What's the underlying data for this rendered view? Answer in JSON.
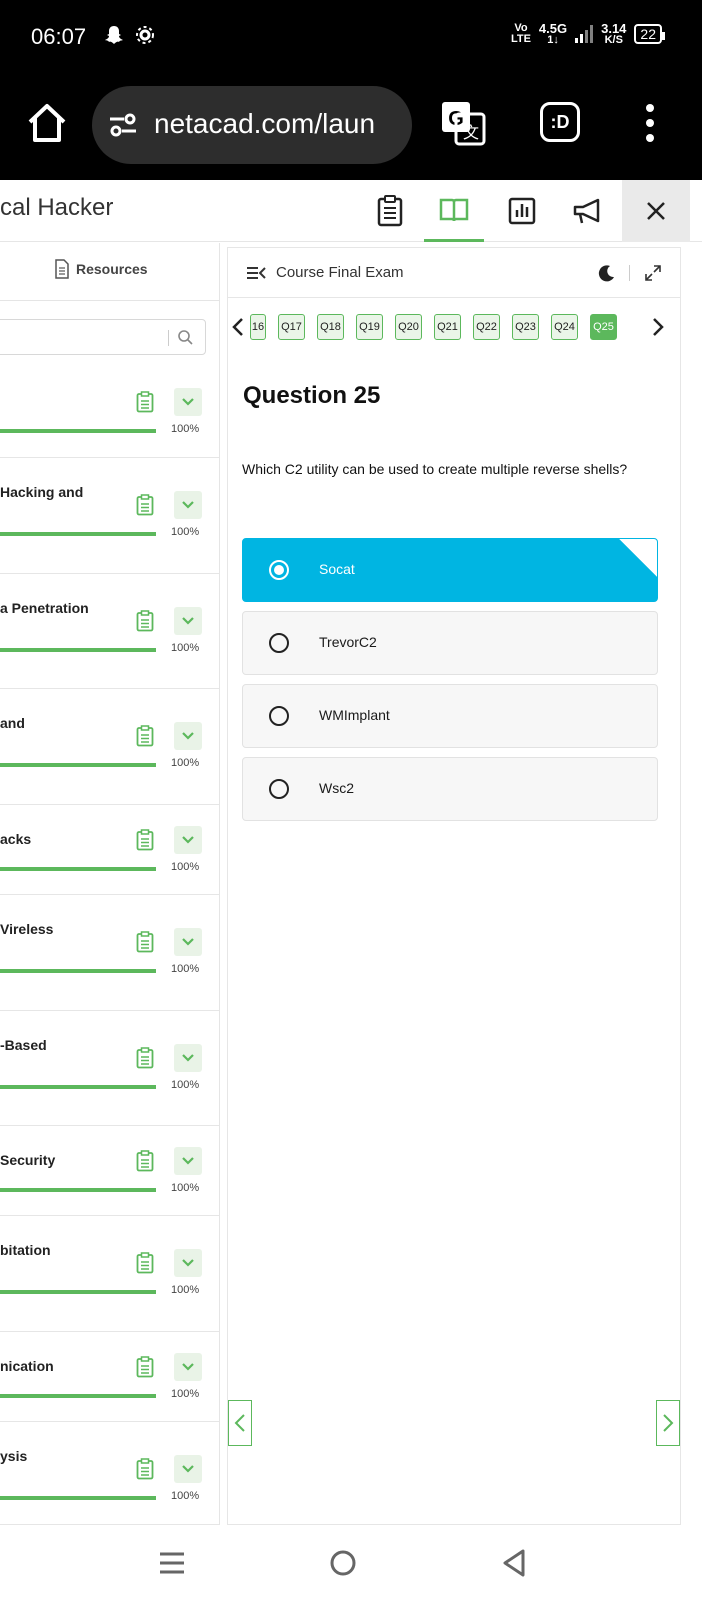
{
  "status_bar": {
    "time": "06:07",
    "network_top": "Vo",
    "network_bottom": "LTE",
    "signal_type": "4.5G",
    "signal_sub": "1↓",
    "speed_value": "3.14",
    "speed_unit": "K/S",
    "battery": "22",
    "icons": [
      "snapchat-icon",
      "settings-icon",
      "signal-icon",
      "battery-icon"
    ]
  },
  "browser": {
    "url": "netacad.com/laun",
    "icons": [
      "home-icon",
      "site-settings-icon",
      "translate-icon",
      "dex-icon",
      "more-vert-icon"
    ]
  },
  "app": {
    "title": "cal Hacker",
    "toolbar_icons": [
      "clipboard-icon",
      "book-icon",
      "chart-icon",
      "megaphone-icon",
      "close-icon"
    ]
  },
  "sidebar": {
    "resources_label": "Resources",
    "search_placeholder": "",
    "modules": [
      {
        "title": "",
        "percent": "100%",
        "progress": 1.0
      },
      {
        "title": "Hacking and",
        "percent": "100%",
        "progress": 1.0
      },
      {
        "title": "a Penetration",
        "percent": "100%",
        "progress": 1.0
      },
      {
        "title": "and",
        "percent": "100%",
        "progress": 1.0
      },
      {
        "title": "acks",
        "percent": "100%",
        "progress": 1.0
      },
      {
        "title": "Vireless",
        "percent": "100%",
        "progress": 1.0
      },
      {
        "title": "-Based",
        "percent": "100%",
        "progress": 1.0
      },
      {
        "title": "Security",
        "percent": "100%",
        "progress": 1.0
      },
      {
        "title": "bitation",
        "percent": "100%",
        "progress": 1.0
      },
      {
        "title": "nication",
        "percent": "100%",
        "progress": 1.0
      },
      {
        "title": "ysis",
        "percent": "100%",
        "progress": 1.0
      }
    ]
  },
  "exam": {
    "title": "Course Final Exam",
    "question_pills": [
      "16",
      "Q17",
      "Q18",
      "Q19",
      "Q20",
      "Q21",
      "Q22",
      "Q23",
      "Q24",
      "Q25"
    ],
    "current_pill": "Q25",
    "question_title": "Question 25",
    "question_text": "Which C2 utility can be used to create multiple reverse shells?",
    "options": [
      {
        "label": "Socat",
        "selected": true
      },
      {
        "label": "TrevorC2",
        "selected": false
      },
      {
        "label": "WMImplant",
        "selected": false
      },
      {
        "label": "Wsc2",
        "selected": false
      }
    ]
  },
  "colors": {
    "accent_green": "#5cb85c",
    "selected_blue": "#00b5e2"
  },
  "navbar": {
    "icons": [
      "recents-icon",
      "home-circle-icon",
      "back-icon"
    ]
  }
}
